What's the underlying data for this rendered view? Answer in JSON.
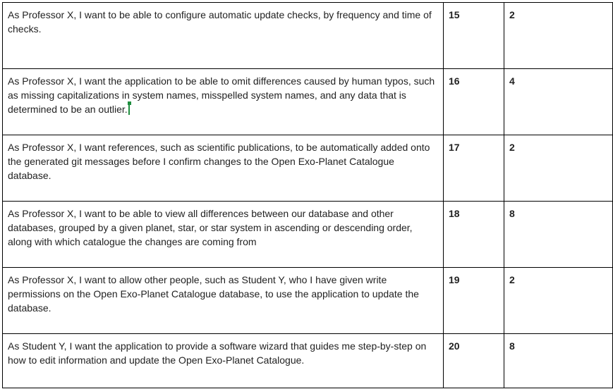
{
  "rows": [
    {
      "story": "As Professor X, I want to be able to configure automatic update checks, by frequency and time of checks.",
      "id": "15",
      "points": "2"
    },
    {
      "story": "As Professor X, I want the application to be able to omit differences caused by human typos, such as missing capitalizations in system names, misspelled system names, and any data that is determined to be an outlier.",
      "id": "16",
      "points": "4"
    },
    {
      "story": "As Professor X, I want references, such as scientific publications, to be automatically added onto the generated git messages before I confirm changes to the Open Exo-Planet Catalogue database.",
      "id": "17",
      "points": "2"
    },
    {
      "story": "As Professor X, I want to be able to view all differences between our database and other databases, grouped by a given planet, star, or star system in ascending or descending order, along with which catalogue the changes are coming from",
      "id": "18",
      "points": "8"
    },
    {
      "story": "As Professor X, I want to allow other people, such as Student Y, who I have given write permissions on the Open Exo-Planet Catalogue database, to use the application to update the database.",
      "id": "19",
      "points": "2"
    },
    {
      "story": "As Student Y, I want the application to provide a software wizard that guides me step-by-step on how to edit information and update the Open Exo-Planet Catalogue.",
      "id": "20",
      "points": "8"
    }
  ],
  "cursor_color": "#1e8e3e"
}
